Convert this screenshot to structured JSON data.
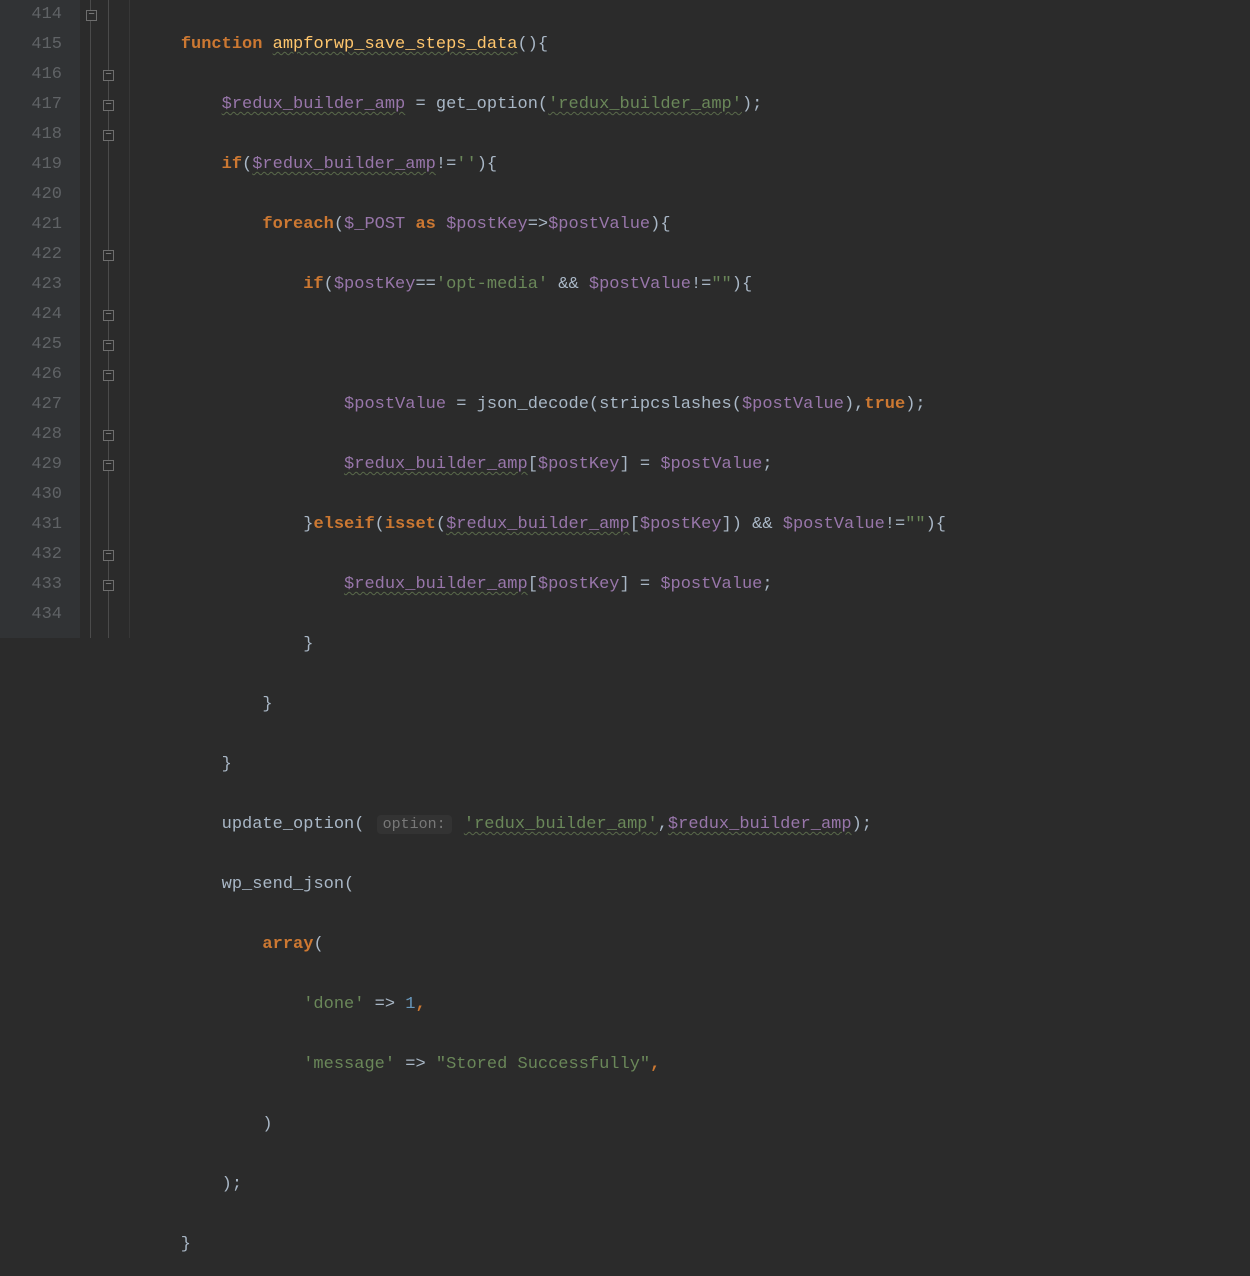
{
  "gutter": {
    "start": 414,
    "lines": [
      "414",
      "415",
      "416",
      "417",
      "418",
      "419",
      "420",
      "421",
      "422",
      "423",
      "424",
      "425",
      "426",
      "427",
      "428",
      "429",
      "430",
      "431",
      "432",
      "433",
      "434"
    ]
  },
  "code": {
    "l414": {
      "kw1": "function",
      "fn": "ampforwp_save_steps_data",
      "tail": "(){"
    },
    "l415": {
      "ind": "        ",
      "v1": "$redux_builder_amp",
      "eq": " = ",
      "fn": "get_option",
      "op": "(",
      "str": "'redux_builder_amp'",
      "cl": ");"
    },
    "l416": {
      "ind": "        ",
      "kw": "if",
      "op": "(",
      "v": "$redux_builder_amp",
      "cmp": "!=",
      "str": "''",
      "cl": "){"
    },
    "l417": {
      "ind": "            ",
      "kw": "foreach",
      "op": "(",
      "v1": "$_POST",
      "as": "as",
      "v2": "$postKey",
      "arr": "=>",
      "v3": "$postValue",
      "cl": "){"
    },
    "l418": {
      "ind": "                ",
      "kw": "if",
      "op": "(",
      "v1": "$postKey",
      "cmp": "==",
      "str": "'opt-media'",
      "amp": " && ",
      "v2": "$postValue",
      "neq": "!=",
      "str2": "\"\"",
      "cl": "){"
    },
    "l419": {
      "ind": ""
    },
    "l420": {
      "ind": "                    ",
      "v1": "$postValue",
      "eq": " = ",
      "fn1": "json_decode",
      "op": "(",
      "fn2": "stripcslashes",
      "op2": "(",
      "v2": "$postValue",
      "cl2": "),",
      "bool": "true",
      "cl": ");"
    },
    "l421": {
      "ind": "                    ",
      "v1": "$redux_builder_amp",
      "br": "[",
      "v2": "$postKey",
      "cbr": "] = ",
      "v3": "$postValue",
      "sc": ";"
    },
    "l422": {
      "ind": "                }",
      "kw": "elseif",
      "op": "(",
      "fn": "isset",
      "op2": "(",
      "v1": "$redux_builder_amp",
      "br": "[",
      "v2": "$postKey",
      "cbr": "]) && ",
      "v3": "$postValue",
      "neq": "!=",
      "str": "\"\"",
      "cl": "){"
    },
    "l423": {
      "ind": "                    ",
      "v1": "$redux_builder_amp",
      "br": "[",
      "v2": "$postKey",
      "cbr": "] = ",
      "v3": "$postValue",
      "sc": ";"
    },
    "l424": {
      "ind": "                }"
    },
    "l425": {
      "ind": "            }"
    },
    "l426": {
      "ind": "        }"
    },
    "l427": {
      "ind": "        ",
      "fn": "update_option",
      "op": "( ",
      "hint": "option:",
      "sp": " ",
      "str": "'redux_builder_amp'",
      "cm": ",",
      "v": "$redux_builder_amp",
      "cl": ");"
    },
    "l428": {
      "ind": "        ",
      "fn": "wp_send_json",
      "op": "("
    },
    "l429": {
      "ind": "            ",
      "kw": "array",
      "op": "("
    },
    "l430": {
      "ind": "                ",
      "str": "'done'",
      "arr": " => ",
      "num": "1",
      "cm": ","
    },
    "l431": {
      "ind": "                ",
      "str": "'message'",
      "arr": " => ",
      "str2": "\"Stored Successfully\"",
      "cm": ","
    },
    "l432": {
      "ind": "            )"
    },
    "l433": {
      "ind": "        );"
    },
    "l434": {
      "ind": "    }"
    }
  }
}
